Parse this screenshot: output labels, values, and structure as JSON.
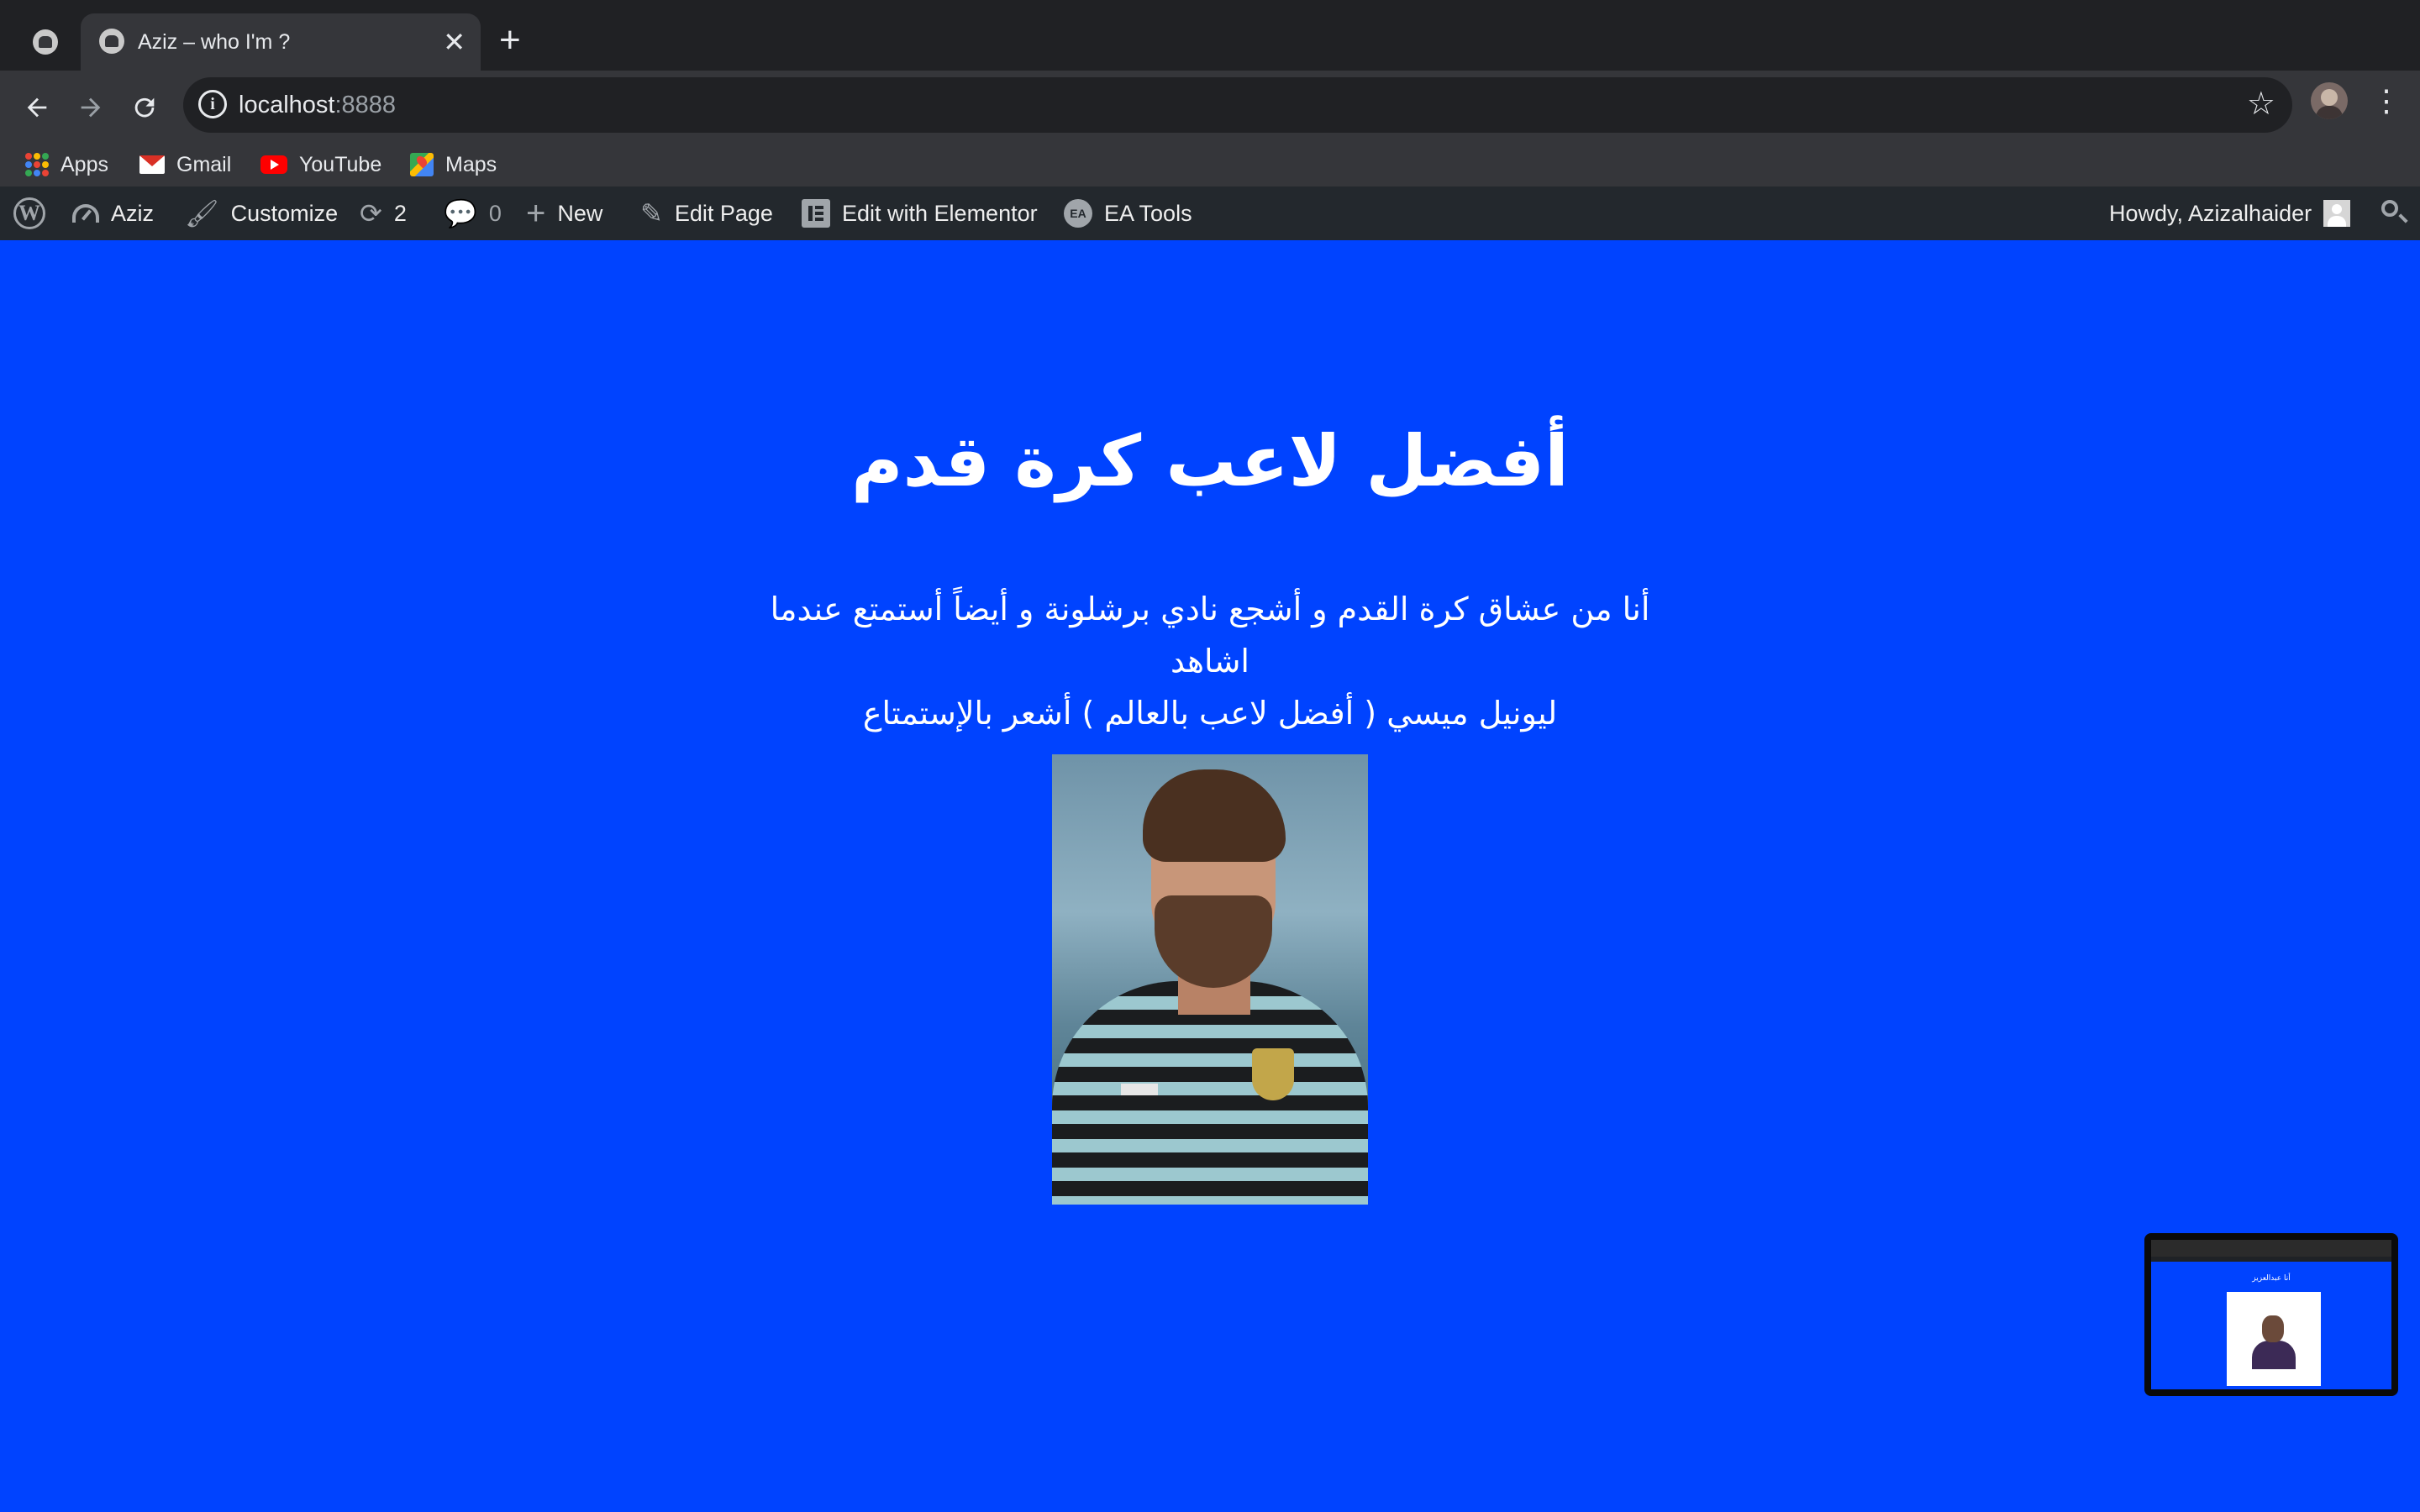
{
  "browser": {
    "tab_title": "Aziz – who I'm ?",
    "url_host": "localhost",
    "url_port": ":8888",
    "bookmarks": [
      {
        "label": "Apps",
        "icon": "apps-grid-icon"
      },
      {
        "label": "Gmail",
        "icon": "gmail-icon"
      },
      {
        "label": "YouTube",
        "icon": "youtube-icon"
      },
      {
        "label": "Maps",
        "icon": "maps-icon"
      }
    ]
  },
  "adminbar": {
    "site_name": "Aziz",
    "customize": "Customize",
    "updates_count": "2",
    "comments_count": "0",
    "new": "New",
    "edit_page": "Edit Page",
    "edit_elementor": "Edit with Elementor",
    "ea_tools": "EA Tools",
    "ea_icon_text": "EA",
    "howdy": "Howdy, Azizalhaider"
  },
  "page": {
    "heading": "أفضل لاعب كرة قدم",
    "paragraph_line1": "أنا من عشاق كرة القدم و أشجع نادي برشلونة و أيضاً أستمتع عندما اشاهد",
    "paragraph_line2": "ليونيل ميسي ( أفضل  لاعب بالعالم ) أشعر بالإستمتاع",
    "background_color": "#0043ff"
  },
  "preview": {
    "title": "أنا عبدالعزيز"
  },
  "colors": {
    "chrome_dark": "#202124",
    "chrome_toolbar": "#35363a",
    "wp_adminbar": "#23282d",
    "page_blue": "#0043ff"
  }
}
